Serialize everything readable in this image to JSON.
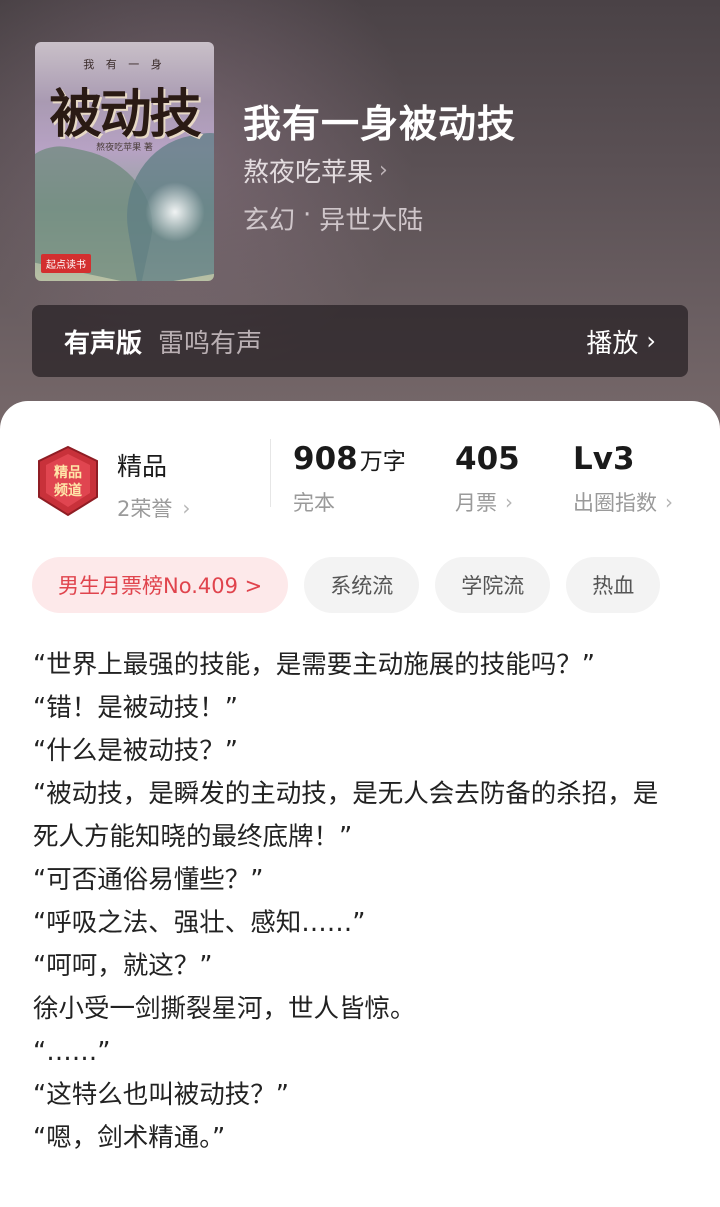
{
  "book": {
    "title": "我有一身被动技",
    "author": "熬夜吃苹果",
    "genre": [
      "玄幻",
      "·",
      "异世大陆"
    ],
    "cover": {
      "top_text": "我 有 一 身",
      "title_text": "被动技",
      "author_text": "熬夜吃苹果 著",
      "badge": "起点读书"
    }
  },
  "audio": {
    "label": "有声版",
    "narrator": "雷鸣有声",
    "play_label": "播放"
  },
  "honor": {
    "badge_line1": "精品",
    "badge_line2": "频道",
    "title": "精品",
    "subtitle": "2荣誉"
  },
  "stats": [
    {
      "value": "908",
      "unit": "万字",
      "label": "完本",
      "has_arrow": false
    },
    {
      "value": "405",
      "unit": "",
      "label": "月票",
      "has_arrow": true
    },
    {
      "value": "Lv3",
      "unit": "",
      "label": "出圈指数",
      "has_arrow": true
    }
  ],
  "tags": [
    {
      "label": "男生月票榜No.409 >",
      "highlight": true
    },
    {
      "label": "系统流"
    },
    {
      "label": "学院流"
    },
    {
      "label": "热血"
    }
  ],
  "intro": [
    "“世界上最强的技能，是需要主动施展的技能吗？”",
    "“错！是被动技！”",
    "“什么是被动技？”",
    "“被动技，是瞬发的主动技，是无人会去防备的杀招，是死人方能知晓的最终底牌！”",
    "“可否通俗易懂些？”",
    "“呼吸之法、强壮、感知……”",
    "“呵呵，就这？”",
    "徐小受一剑撕裂星河，世人皆惊。",
    "“……”",
    "“这特么也叫被动技？”",
    "“嗯，剑术精通。”"
  ],
  "colors": {
    "rank_tag_bg": "#fde9ea",
    "rank_tag_text": "#e0444d",
    "hero_bg": "#5a5054"
  }
}
